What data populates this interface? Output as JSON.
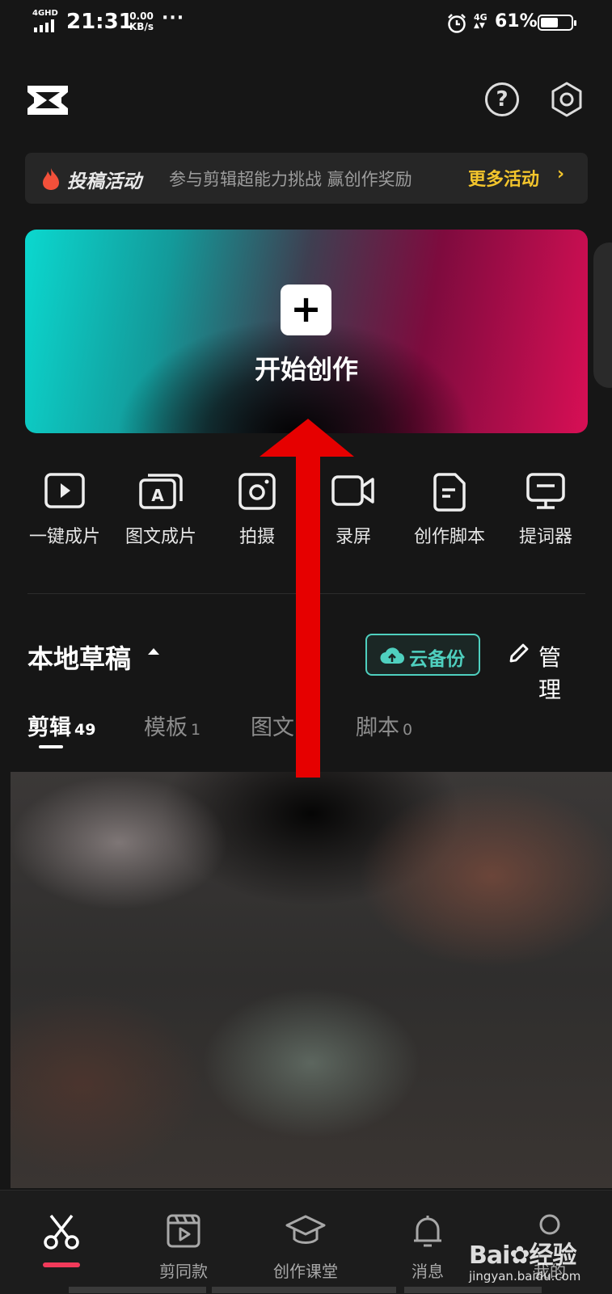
{
  "status_bar": {
    "network": "4GHD",
    "time": "21:31",
    "speed_value": "0.00",
    "speed_unit": "KB/s",
    "more_dots": "···",
    "cellular": "4G",
    "battery_percent": "61%",
    "battery_level": 0.61
  },
  "header": {
    "help_label": "?"
  },
  "promo": {
    "tag": "投稿活动",
    "description": "参与剪辑超能力挑战 赢创作奖励",
    "more": "更多活动",
    "chevron": "›"
  },
  "hero": {
    "plus": "+",
    "label": "开始创作"
  },
  "tools": [
    {
      "label": "一键成片",
      "icon": "play-square-icon"
    },
    {
      "label": "图文成片",
      "icon": "text-image-icon"
    },
    {
      "label": "拍摄",
      "icon": "camera-icon"
    },
    {
      "label": "录屏",
      "icon": "video-camera-icon"
    },
    {
      "label": "创作脚本",
      "icon": "script-doc-icon"
    },
    {
      "label": "提词器",
      "icon": "teleprompter-icon"
    }
  ],
  "drafts": {
    "title": "本地草稿",
    "cloud_backup": "云备份",
    "manage": "管理"
  },
  "tabs": [
    {
      "label": "剪辑",
      "count": "49",
      "active": true
    },
    {
      "label": "模板",
      "count": "1",
      "active": false
    },
    {
      "label": "图文",
      "count": "",
      "active": false
    },
    {
      "label": "脚本",
      "count": "0",
      "active": false
    }
  ],
  "bottom_nav": [
    {
      "label": "",
      "icon": "scissors-icon",
      "active": true
    },
    {
      "label": "剪同款",
      "icon": "clapperboard-icon",
      "active": false
    },
    {
      "label": "创作课堂",
      "icon": "graduation-cap-icon",
      "active": false
    },
    {
      "label": "消息",
      "icon": "bell-icon",
      "active": false
    },
    {
      "label": "我的",
      "icon": "profile-icon",
      "active": false
    }
  ],
  "watermark": {
    "brand": "Bai",
    "brand_suffix": "经验",
    "url": "jingyan.baidu.com"
  },
  "colors": {
    "background": "#161616",
    "accent_teal": "#4fd0bf",
    "promo_yellow": "#f3c52c",
    "nav_active": "#f23a5a",
    "arrow_red": "#e60000"
  }
}
